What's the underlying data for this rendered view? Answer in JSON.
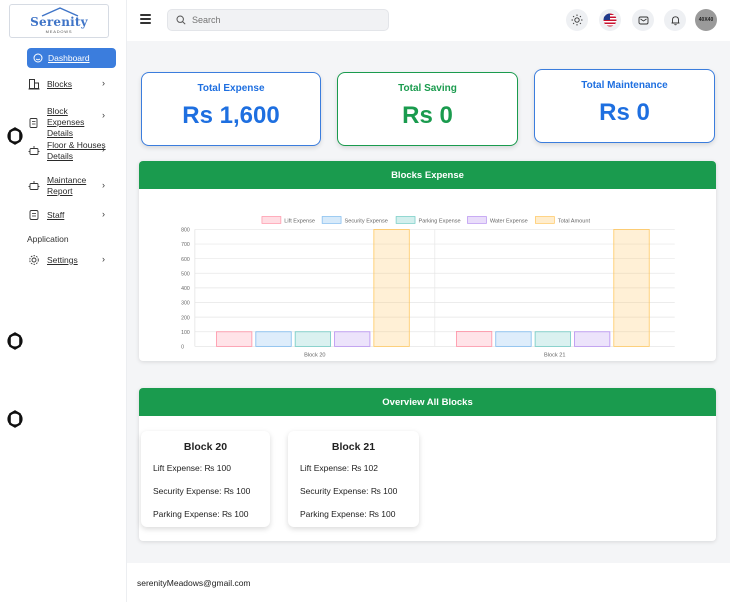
{
  "logo": {
    "name": "Serenity",
    "sub": "MEADOWS"
  },
  "sidebar": {
    "items": [
      {
        "label": "Dashboard"
      },
      {
        "label": "Blocks"
      },
      {
        "label": "Block Expenses Details"
      },
      {
        "label": "Floor & Houses Details"
      },
      {
        "label": "Maintance Report"
      },
      {
        "label": "Staff"
      },
      {
        "label": "Settings"
      }
    ],
    "section_title": "Application"
  },
  "header": {
    "search_placeholder": "Search",
    "avatar_label": "40X40"
  },
  "stats": [
    {
      "title": "Total Expense",
      "value": "Rs 1,600",
      "color": "#1e6fe0"
    },
    {
      "title": "Total Saving",
      "value": "Rs 0",
      "color": "#1a9b4e"
    },
    {
      "title": "Total Maintenance",
      "value": "Rs 0",
      "color": "#1e6fe0"
    }
  ],
  "chart_panel": {
    "title": "Blocks Expense"
  },
  "chart_data": {
    "type": "bar",
    "categories": [
      "Block 20",
      "Block 21"
    ],
    "series": [
      {
        "name": "Lift Expense",
        "values": [
          100,
          102
        ],
        "color": "#ff8fa3"
      },
      {
        "name": "Security Expense",
        "values": [
          100,
          100
        ],
        "color": "#7ab8ee"
      },
      {
        "name": "Parking Expense",
        "values": [
          100,
          100
        ],
        "color": "#6cc9c2"
      },
      {
        "name": "Water Expense",
        "values": [
          100,
          100
        ],
        "color": "#b58ef0"
      },
      {
        "name": "Total Amount",
        "values": [
          800,
          800
        ],
        "color": "#ffc55a"
      }
    ],
    "yticks": [
      "0",
      "100",
      "200",
      "300",
      "400",
      "500",
      "600",
      "700",
      "800"
    ],
    "ylim": [
      0,
      800
    ],
    "legend_position": "top"
  },
  "overview": {
    "title": "Overview All Blocks",
    "blocks": [
      {
        "name": "Block 20",
        "lift": "Lift Expense: ₨ 100",
        "security": "Security Expense: ₨ 100",
        "parking": "Parking Expense: ₨ 100"
      },
      {
        "name": "Block 21",
        "lift": "Lift Expense: ₨ 102",
        "security": "Security Expense: ₨ 100",
        "parking": "Parking Expense: ₨ 100"
      }
    ]
  },
  "footer": {
    "email": "serenityMeadows@gmail.com"
  }
}
